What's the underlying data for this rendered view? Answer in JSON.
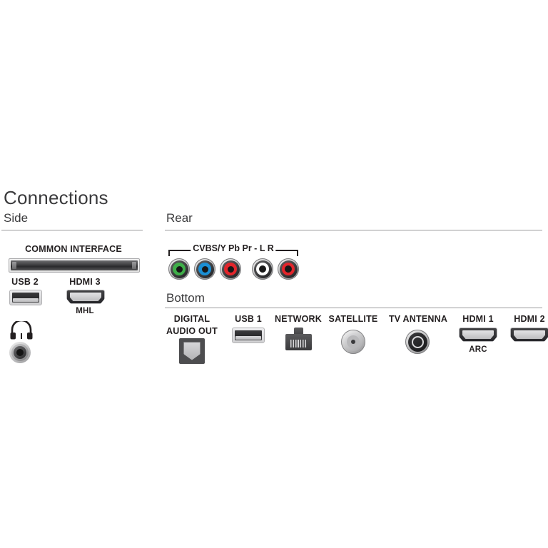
{
  "title": "Connections",
  "sections": {
    "side": {
      "label": "Side"
    },
    "rear": {
      "label": "Rear"
    },
    "bottom": {
      "label": "Bottom"
    }
  },
  "side_ports": {
    "common_interface": {
      "label": "COMMON INTERFACE",
      "icon": "ci-slot-icon"
    },
    "usb2": {
      "label": "USB 2",
      "icon": "usb-port-icon"
    },
    "hdmi3": {
      "label": "HDMI 3",
      "sublabel": "MHL",
      "icon": "hdmi-port-icon"
    },
    "headphone": {
      "icon": "headphone-icon",
      "jack": "headphone-jack-icon"
    }
  },
  "rear_ports": {
    "group_label": "CVBS/Y Pb Pr - L R",
    "jacks": [
      {
        "name": "cvbs-y-jack",
        "color": "#3fae49"
      },
      {
        "name": "pb-jack",
        "color": "#1b8fd4"
      },
      {
        "name": "pr-jack",
        "color": "#e3252b"
      },
      {
        "name": "audio-left-jack",
        "color": "#ffffff"
      },
      {
        "name": "audio-right-jack",
        "color": "#e3252b"
      }
    ]
  },
  "bottom_ports": [
    {
      "label": "DIGITAL",
      "label2": "AUDIO OUT",
      "sublabel": "",
      "icon": "optical-audio-icon"
    },
    {
      "label": "USB 1",
      "label2": "",
      "sublabel": "",
      "icon": "usb-port-icon"
    },
    {
      "label": "NETWORK",
      "label2": "",
      "sublabel": "",
      "icon": "rj45-port-icon"
    },
    {
      "label": "SATELLITE",
      "label2": "",
      "sublabel": "",
      "icon": "satellite-f-connector-icon"
    },
    {
      "label": "TV ANTENNA",
      "label2": "",
      "sublabel": "",
      "icon": "antenna-coax-icon"
    },
    {
      "label": "HDMI 1",
      "label2": "",
      "sublabel": "ARC",
      "icon": "hdmi-port-icon"
    },
    {
      "label": "HDMI 2",
      "label2": "",
      "sublabel": "",
      "icon": "hdmi-port-icon"
    }
  ],
  "colors": {
    "text": "#231f20",
    "heading": "#3a3a3c",
    "rule": "#9b9b9d",
    "background": "#ffffff"
  }
}
